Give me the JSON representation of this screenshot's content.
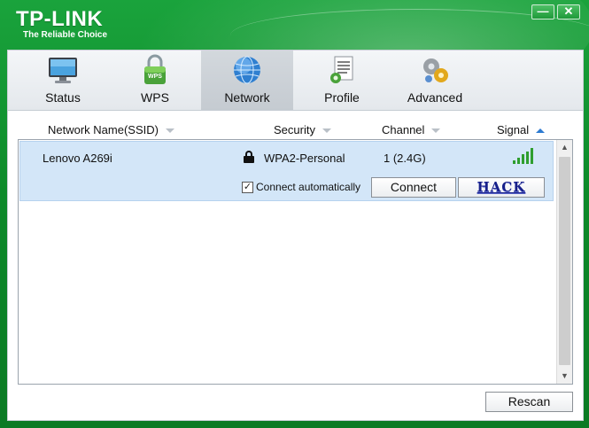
{
  "app": {
    "brand": "TP-LINK",
    "tagline": "The Reliable Choice",
    "window_controls": {
      "minimize_icon": "minimize-icon",
      "close_icon": "close-icon"
    }
  },
  "tabs": [
    {
      "label": "Status",
      "icon": "monitor-icon",
      "active": false
    },
    {
      "label": "WPS",
      "icon": "wps-lock-icon",
      "active": false
    },
    {
      "label": "Network",
      "icon": "globe-icon",
      "active": true
    },
    {
      "label": "Profile",
      "icon": "profile-document-icon",
      "active": false
    },
    {
      "label": "Advanced",
      "icon": "gears-icon",
      "active": false
    }
  ],
  "columns": {
    "ssid": "Network Name(SSID)",
    "security": "Security",
    "channel": "Channel",
    "signal": "Signal",
    "sorted_by": "signal",
    "sort_direction": "ascending"
  },
  "networks": [
    {
      "ssid": "Lenovo A269i",
      "security": "WPA2-Personal",
      "channel": "1 (2.4G)",
      "signal_bars": 5,
      "signal_max": 5,
      "locked": true,
      "connect_automatically_label": "Connect automatically",
      "connect_automatically": true,
      "connect_label": "Connect",
      "hack_label": "HACK"
    }
  ],
  "rescan_label": "Rescan",
  "colors": {
    "frame_green": "#0f8a2e",
    "selected_row": "#d3e6f8",
    "signal_green": "#2f9e2f",
    "sort_active": "#2d7bd1",
    "hack_text": "#17208a"
  }
}
